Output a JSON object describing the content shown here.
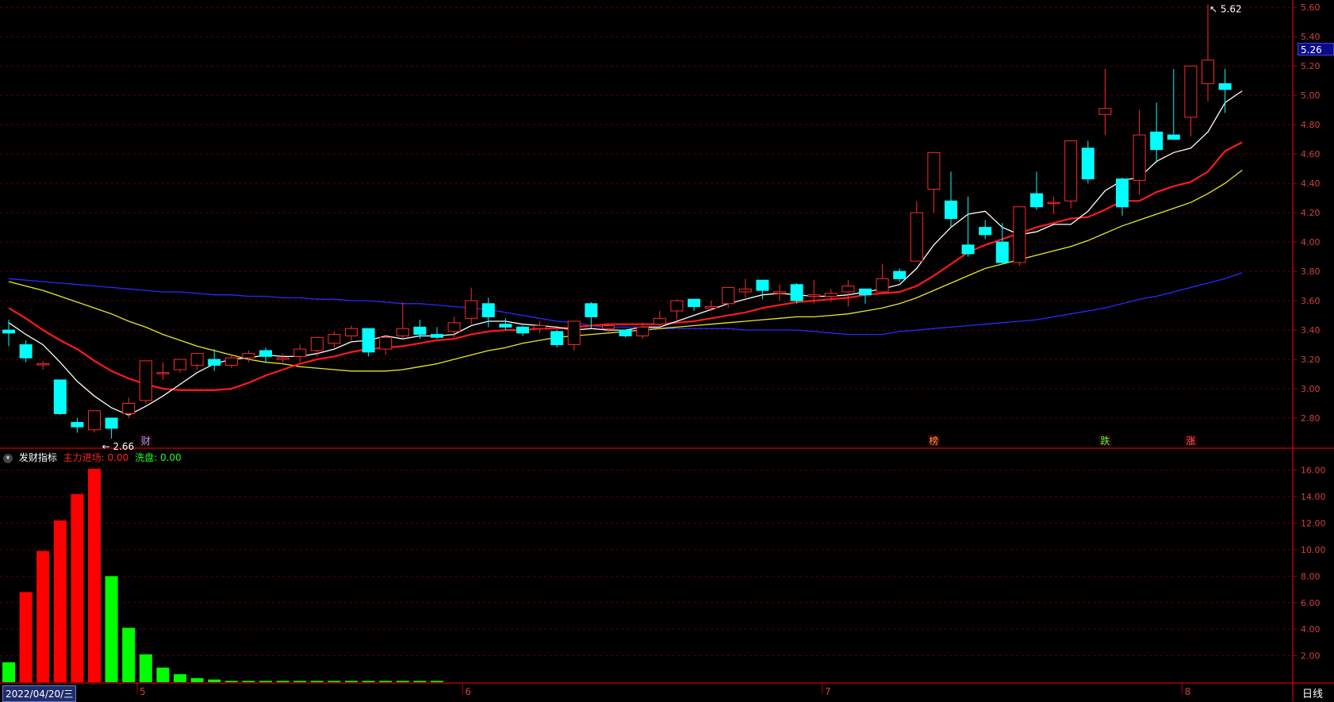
{
  "app": {
    "period_label": "日线",
    "cursor_date": "2022/04/20/三"
  },
  "colors": {
    "up": "#ff2a2a",
    "down": "#00ffff",
    "ma5": "#ffffff",
    "ma10": "#ff1a1a",
    "ma20": "#e8e82a",
    "ma60": "#2a2aff",
    "grid": "#5a0000",
    "axis": "#b00000",
    "ind_pos": "#ff0000",
    "ind_neg": "#00ff00"
  },
  "price_axis": {
    "min": 2.6,
    "max": 5.65,
    "ticks": [
      "5.60",
      "5.40",
      "5.20",
      "5.00",
      "4.80",
      "4.60",
      "4.40",
      "4.20",
      "4.00",
      "3.80",
      "3.60",
      "3.40",
      "3.20",
      "3.00",
      "2.80"
    ]
  },
  "current_price": "5.26",
  "annotations": {
    "low_label": "2.66",
    "high_label": "5.62"
  },
  "markers": [
    {
      "text": "财",
      "bar": 8,
      "color": "#7fa8ff"
    },
    {
      "text": "榜",
      "bar": 54,
      "color": "#ff9a40"
    },
    {
      "text": "跌",
      "bar": 64,
      "color": "#40ff40"
    },
    {
      "text": "涨",
      "bar": 69,
      "color": "#ff6060"
    }
  ],
  "x_axis_labels": [
    {
      "text": "5",
      "bar": 8
    },
    {
      "text": "6",
      "bar": 27
    },
    {
      "text": "7",
      "bar": 48
    },
    {
      "text": "8",
      "bar": 69
    }
  ],
  "indicator": {
    "name": "发财指标",
    "line1_label": "主力进场:",
    "line1_value": "0.00",
    "line2_label": "洗盘:",
    "line2_value": "0.00",
    "axis_ticks": [
      "16.00",
      "14.00",
      "12.00",
      "10.00",
      "8.00",
      "6.00",
      "4.00",
      "2.00"
    ],
    "max": 17.0
  },
  "chart_data": {
    "type": "candlestick",
    "candles": [
      [
        3.4,
        3.38,
        3.47,
        3.29
      ],
      [
        3.3,
        3.21,
        3.33,
        3.18
      ],
      [
        3.17,
        3.17,
        3.19,
        3.13
      ],
      [
        3.06,
        2.83,
        3.06,
        2.82
      ],
      [
        2.77,
        2.74,
        2.8,
        2.7
      ],
      [
        2.72,
        2.85,
        2.85,
        2.7
      ],
      [
        2.8,
        2.73,
        2.8,
        2.66
      ],
      [
        2.83,
        2.9,
        2.94,
        2.8
      ],
      [
        2.92,
        3.19,
        3.19,
        2.9
      ],
      [
        3.11,
        3.11,
        3.18,
        3.06
      ],
      [
        3.13,
        3.2,
        3.2,
        3.11
      ],
      [
        3.16,
        3.24,
        3.24,
        3.13
      ],
      [
        3.2,
        3.16,
        3.27,
        3.12
      ],
      [
        3.16,
        3.21,
        3.23,
        3.14
      ],
      [
        3.21,
        3.24,
        3.26,
        3.18
      ],
      [
        3.26,
        3.22,
        3.28,
        3.18
      ],
      [
        3.2,
        3.21,
        3.24,
        3.18
      ],
      [
        3.22,
        3.27,
        3.3,
        3.18
      ],
      [
        3.26,
        3.35,
        3.35,
        3.22
      ],
      [
        3.31,
        3.37,
        3.39,
        3.28
      ],
      [
        3.36,
        3.41,
        3.43,
        3.33
      ],
      [
        3.41,
        3.25,
        3.41,
        3.22
      ],
      [
        3.27,
        3.35,
        3.36,
        3.23
      ],
      [
        3.36,
        3.41,
        3.59,
        3.34
      ],
      [
        3.42,
        3.37,
        3.47,
        3.34
      ],
      [
        3.37,
        3.35,
        3.42,
        3.34
      ],
      [
        3.39,
        3.45,
        3.49,
        3.35
      ],
      [
        3.48,
        3.6,
        3.69,
        3.44
      ],
      [
        3.58,
        3.49,
        3.62,
        3.42
      ],
      [
        3.44,
        3.42,
        3.48,
        3.4
      ],
      [
        3.42,
        3.38,
        3.43,
        3.36
      ],
      [
        3.41,
        3.43,
        3.46,
        3.38
      ],
      [
        3.39,
        3.3,
        3.4,
        3.28
      ],
      [
        3.3,
        3.46,
        3.46,
        3.26
      ],
      [
        3.58,
        3.49,
        3.59,
        3.41
      ],
      [
        3.41,
        3.43,
        3.44,
        3.38
      ],
      [
        3.4,
        3.36,
        3.4,
        3.35
      ],
      [
        3.36,
        3.42,
        3.45,
        3.34
      ],
      [
        3.44,
        3.48,
        3.53,
        3.42
      ],
      [
        3.53,
        3.6,
        3.61,
        3.47
      ],
      [
        3.61,
        3.56,
        3.61,
        3.53
      ],
      [
        3.55,
        3.56,
        3.6,
        3.53
      ],
      [
        3.58,
        3.69,
        3.69,
        3.55
      ],
      [
        3.66,
        3.68,
        3.75,
        3.62
      ],
      [
        3.74,
        3.67,
        3.74,
        3.61
      ],
      [
        3.65,
        3.66,
        3.71,
        3.6
      ],
      [
        3.71,
        3.6,
        3.72,
        3.58
      ],
      [
        3.63,
        3.64,
        3.74,
        3.58
      ],
      [
        3.63,
        3.65,
        3.68,
        3.59
      ],
      [
        3.66,
        3.7,
        3.74,
        3.56
      ],
      [
        3.68,
        3.64,
        3.68,
        3.58
      ],
      [
        3.66,
        3.75,
        3.85,
        3.65
      ],
      [
        3.8,
        3.75,
        3.82,
        3.73
      ],
      [
        3.87,
        4.2,
        4.28,
        3.87
      ],
      [
        4.36,
        4.61,
        4.61,
        4.2
      ],
      [
        4.28,
        4.16,
        4.48,
        4.1
      ],
      [
        3.98,
        3.92,
        4.31,
        3.9
      ],
      [
        4.1,
        4.05,
        4.15,
        4.02
      ],
      [
        4.0,
        3.86,
        4.13,
        3.85
      ],
      [
        3.86,
        4.24,
        4.24,
        3.84
      ],
      [
        4.33,
        4.24,
        4.48,
        4.22
      ],
      [
        4.27,
        4.27,
        4.31,
        4.19
      ],
      [
        4.28,
        4.69,
        4.69,
        4.23
      ],
      [
        4.64,
        4.43,
        4.69,
        4.4
      ],
      [
        4.87,
        4.91,
        5.18,
        4.73
      ],
      [
        4.43,
        4.24,
        4.44,
        4.18
      ],
      [
        4.42,
        4.73,
        4.9,
        4.32
      ],
      [
        4.75,
        4.63,
        4.95,
        4.54
      ],
      [
        4.73,
        4.7,
        5.18,
        4.7
      ],
      [
        4.85,
        5.2,
        5.2,
        4.72
      ],
      [
        5.08,
        5.24,
        5.62,
        4.96
      ],
      [
        5.08,
        5.04,
        5.18,
        4.88
      ]
    ],
    "ma5": [
      3.45,
      3.37,
      3.3,
      3.18,
      3.05,
      2.95,
      2.87,
      2.82,
      2.88,
      2.95,
      3.03,
      3.11,
      3.17,
      3.2,
      3.21,
      3.23,
      3.22,
      3.22,
      3.24,
      3.27,
      3.32,
      3.33,
      3.36,
      3.34,
      3.36,
      3.36,
      3.37,
      3.43,
      3.46,
      3.46,
      3.44,
      3.43,
      3.42,
      3.4,
      3.41,
      3.4,
      3.4,
      3.42,
      3.42,
      3.46,
      3.5,
      3.54,
      3.58,
      3.61,
      3.64,
      3.65,
      3.64,
      3.63,
      3.63,
      3.64,
      3.66,
      3.68,
      3.71,
      3.82,
      3.98,
      4.1,
      4.19,
      4.21,
      4.1,
      4.05,
      4.07,
      4.12,
      4.12,
      4.21,
      4.35,
      4.42,
      4.44,
      4.55,
      4.61,
      4.64,
      4.75,
      4.95,
      5.03
    ],
    "ma10": [
      3.55,
      3.48,
      3.4,
      3.33,
      3.27,
      3.19,
      3.12,
      3.07,
      3.03,
      3.0,
      2.99,
      2.99,
      2.99,
      3.0,
      3.04,
      3.09,
      3.13,
      3.17,
      3.2,
      3.22,
      3.25,
      3.27,
      3.28,
      3.29,
      3.31,
      3.33,
      3.34,
      3.37,
      3.39,
      3.4,
      3.4,
      3.41,
      3.41,
      3.42,
      3.43,
      3.44,
      3.44,
      3.44,
      3.44,
      3.45,
      3.46,
      3.48,
      3.5,
      3.52,
      3.55,
      3.57,
      3.59,
      3.6,
      3.61,
      3.62,
      3.64,
      3.65,
      3.66,
      3.7,
      3.77,
      3.85,
      3.93,
      3.98,
      4.02,
      4.06,
      4.1,
      4.13,
      4.16,
      4.17,
      4.22,
      4.28,
      4.28,
      4.34,
      4.38,
      4.41,
      4.48,
      4.62,
      4.68
    ],
    "ma20": [
      3.73,
      3.7,
      3.67,
      3.63,
      3.59,
      3.55,
      3.51,
      3.46,
      3.42,
      3.37,
      3.33,
      3.29,
      3.26,
      3.23,
      3.2,
      3.18,
      3.17,
      3.15,
      3.14,
      3.13,
      3.12,
      3.12,
      3.12,
      3.13,
      3.15,
      3.17,
      3.2,
      3.23,
      3.26,
      3.28,
      3.31,
      3.33,
      3.35,
      3.36,
      3.37,
      3.38,
      3.39,
      3.4,
      3.41,
      3.42,
      3.43,
      3.44,
      3.45,
      3.46,
      3.47,
      3.48,
      3.49,
      3.49,
      3.5,
      3.51,
      3.53,
      3.55,
      3.58,
      3.62,
      3.67,
      3.72,
      3.77,
      3.82,
      3.85,
      3.88,
      3.91,
      3.94,
      3.97,
      4.01,
      4.06,
      4.11,
      4.15,
      4.19,
      4.23,
      4.27,
      4.33,
      4.4,
      4.49
    ],
    "ma60": [
      3.75,
      3.74,
      3.73,
      3.72,
      3.71,
      3.7,
      3.69,
      3.68,
      3.67,
      3.66,
      3.66,
      3.65,
      3.64,
      3.64,
      3.63,
      3.63,
      3.62,
      3.62,
      3.61,
      3.61,
      3.6,
      3.6,
      3.59,
      3.58,
      3.58,
      3.57,
      3.56,
      3.55,
      3.54,
      3.52,
      3.5,
      3.48,
      3.46,
      3.45,
      3.43,
      3.42,
      3.42,
      3.42,
      3.41,
      3.41,
      3.41,
      3.41,
      3.41,
      3.4,
      3.4,
      3.4,
      3.4,
      3.39,
      3.38,
      3.37,
      3.37,
      3.37,
      3.39,
      3.4,
      3.41,
      3.42,
      3.43,
      3.44,
      3.45,
      3.46,
      3.47,
      3.49,
      3.51,
      3.53,
      3.55,
      3.58,
      3.61,
      3.63,
      3.66,
      3.69,
      3.72,
      3.75,
      3.79
    ],
    "indicator_bars": [
      {
        "value": 1.5,
        "sign": "neg"
      },
      {
        "value": 6.8,
        "sign": "pos"
      },
      {
        "value": 9.9,
        "sign": "pos"
      },
      {
        "value": 12.2,
        "sign": "pos"
      },
      {
        "value": 14.2,
        "sign": "pos"
      },
      {
        "value": 16.1,
        "sign": "pos"
      },
      {
        "value": 8.0,
        "sign": "neg"
      },
      {
        "value": 4.1,
        "sign": "neg"
      },
      {
        "value": 2.1,
        "sign": "neg"
      },
      {
        "value": 1.1,
        "sign": "neg"
      },
      {
        "value": 0.6,
        "sign": "neg"
      },
      {
        "value": 0.3,
        "sign": "neg"
      },
      {
        "value": 0.2,
        "sign": "neg"
      },
      {
        "value": 0.1,
        "sign": "neg"
      },
      {
        "value": 0.1,
        "sign": "neg"
      },
      {
        "value": 0.1,
        "sign": "neg"
      },
      {
        "value": 0.1,
        "sign": "neg"
      },
      {
        "value": 0.1,
        "sign": "neg"
      },
      {
        "value": 0.1,
        "sign": "neg"
      },
      {
        "value": 0.1,
        "sign": "neg"
      },
      {
        "value": 0.1,
        "sign": "neg"
      },
      {
        "value": 0.1,
        "sign": "neg"
      },
      {
        "value": 0.1,
        "sign": "neg"
      },
      {
        "value": 0.1,
        "sign": "neg"
      },
      {
        "value": 0.1,
        "sign": "neg"
      },
      {
        "value": 0.1,
        "sign": "neg"
      }
    ]
  }
}
